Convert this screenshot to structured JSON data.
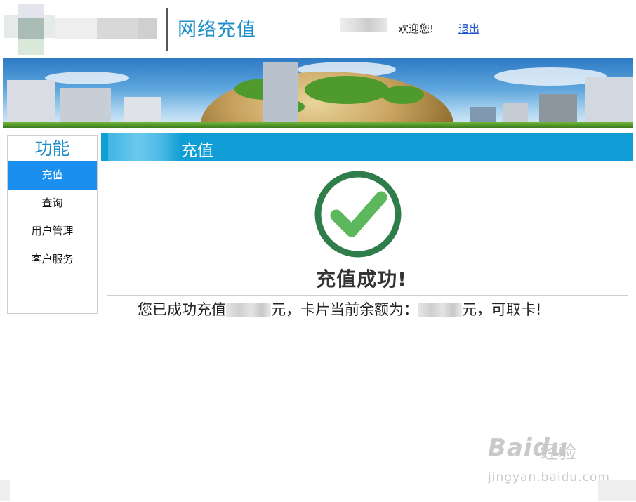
{
  "header": {
    "title": "网络充值",
    "welcome": "欢迎您!",
    "logout": "退出"
  },
  "sidebar": {
    "title": "功能",
    "items": [
      {
        "label": "充值",
        "active": true
      },
      {
        "label": "查询",
        "active": false
      },
      {
        "label": "用户管理",
        "active": false
      },
      {
        "label": "客户服务",
        "active": false
      }
    ]
  },
  "content": {
    "section_title": "充值",
    "success_title": "充值成功!",
    "message": {
      "part1": "您已成功充值",
      "part2": "元，卡片当前余额为：",
      "part3": "元，可取卡!"
    }
  },
  "watermark": {
    "brand": "Baidu",
    "brand_cn": "经验",
    "url": "jingyan.baidu.com"
  },
  "colors": {
    "accent": "#119dd5",
    "active_nav": "#1a8ff0",
    "title_blue": "#1f8fc8",
    "check_green": "#2e7d4a"
  },
  "icons": {
    "success": "check-circle-icon"
  }
}
